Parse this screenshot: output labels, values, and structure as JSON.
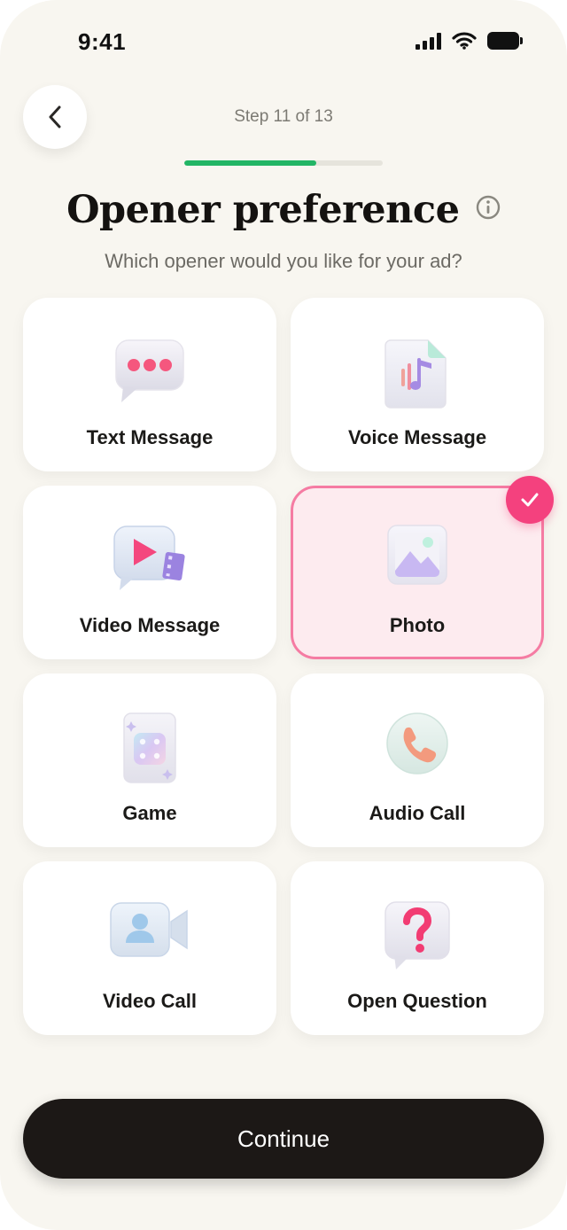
{
  "status_bar": {
    "time": "9:41"
  },
  "header": {
    "step_text": "Step 11 of 13",
    "progress": 0.6666,
    "title": "Opener preference",
    "subtitle": "Which opener would you like for your ad?"
  },
  "options": [
    {
      "label": "Text Message",
      "icon": "chat-bubble-icon",
      "selected": false
    },
    {
      "label": "Voice Message",
      "icon": "audio-file-icon",
      "selected": false
    },
    {
      "label": "Video Message",
      "icon": "video-bubble-icon",
      "selected": false
    },
    {
      "label": "Photo",
      "icon": "photo-icon",
      "selected": true
    },
    {
      "label": "Game",
      "icon": "dice-card-icon",
      "selected": false
    },
    {
      "label": "Audio Call",
      "icon": "phone-icon",
      "selected": false
    },
    {
      "label": "Video Call",
      "icon": "video-camera-icon",
      "selected": false
    },
    {
      "label": "Open Question",
      "icon": "question-bubble-icon",
      "selected": false
    }
  ],
  "footer": {
    "continue_label": "Continue"
  },
  "colors": {
    "accent": "#22b565",
    "selected_border": "#f57ca3",
    "selected_bg": "#fdebef",
    "check": "#f4417e",
    "button": "#1c1816"
  }
}
